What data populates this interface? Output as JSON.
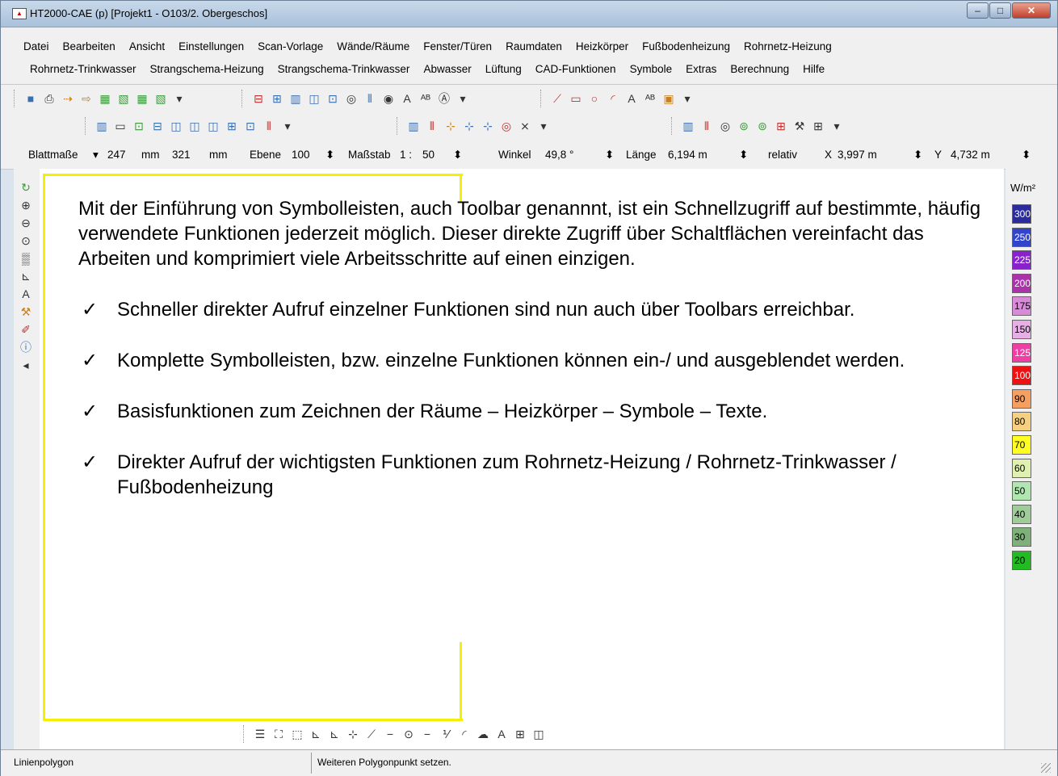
{
  "window": {
    "title": "HT2000-CAE (p)  [Projekt1 - O103/2. Obergeschos]",
    "app_icon": "app-logo-icon",
    "btn_min": "–",
    "btn_max": "□",
    "btn_close": "✕"
  },
  "menu": {
    "row1": [
      "Datei",
      "Bearbeiten",
      "Ansicht",
      "Einstellungen",
      "Scan-Vorlage",
      "Wände/Räume",
      "Fenster/Türen",
      "Raumdaten",
      "Heizkörper",
      "Fußbodenheizung",
      "Rohrnetz-Heizung"
    ],
    "row2": [
      "Rohrnetz-Trinkwasser",
      "Strangschema-Heizung",
      "Strangschema-Trinkwasser",
      "Abwasser",
      "Lüftung",
      "CAD-Funktionen",
      "Symbole",
      "Extras",
      "Berechnung",
      "Hilfe"
    ]
  },
  "propbar": {
    "blattmasse_label": "Blattmaße",
    "blattmasse_dropdown": "▾",
    "width": "247",
    "width_unit": "mm",
    "height": "321",
    "height_unit": "mm",
    "ebene_label": "Ebene",
    "ebene_value": "100",
    "massstab_label": "Maßstab",
    "massstab_prefix": "1 :",
    "massstab_value": "50",
    "winkel_label": "Winkel",
    "winkel_value": "49,8 °",
    "laenge_label": "Länge",
    "laenge_value": "6,194 m",
    "relativ_label": "relativ",
    "x_label": "X",
    "x_value": "3,997 m",
    "y_label": "Y",
    "y_value": "4,732 m",
    "spin_glyph": "⬍"
  },
  "overlay": {
    "intro": "Mit der Einführung von Symbolleisten, auch Toolbar genannnt, ist ein Schnellzugriff auf bestimmte, häufig verwendete Funktionen jederzeit möglich. Dieser direkte Zugriff über Schaltflächen vereinfacht das Arbeiten und komprimiert viele Arbeitsschritte auf einen einzigen.",
    "check_glyph": "✓",
    "bullets": [
      "Schneller direkter Aufruf einzelner Funktionen sind nun auch über Toolbars erreichbar.",
      "Komplette Symbolleisten, bzw. einzelne Funktionen können ein-/ und ausgeblendet werden.",
      "Basisfunktionen zum Zeichnen der Räume – Heizkörper – Symbole – Texte.",
      "Direkter Aufruf der wichtigsten Funktionen zum Rohrnetz-Heizung / Rohrnetz-Trinkwasser / Fußbodenheizung"
    ]
  },
  "legend": {
    "unit_label": "W/m²",
    "items": [
      {
        "label": "300",
        "color": "#2b2b9e"
      },
      {
        "label": "250",
        "color": "#3344cc"
      },
      {
        "label": "225",
        "color": "#8822cc"
      },
      {
        "label": "200",
        "color": "#aa33aa"
      },
      {
        "label": "175",
        "color": "#d98ad9"
      },
      {
        "label": "150",
        "color": "#e6b0e6"
      },
      {
        "label": "125",
        "color": "#ee3fa5"
      },
      {
        "label": "100",
        "color": "#ee1111"
      },
      {
        "label": "90",
        "color": "#f5a060"
      },
      {
        "label": "80",
        "color": "#f5d080"
      },
      {
        "label": "70",
        "color": "#ffff22"
      },
      {
        "label": "60",
        "color": "#dff0b0"
      },
      {
        "label": "50",
        "color": "#b0e6b0"
      },
      {
        "label": "40",
        "color": "#a0cc9a"
      },
      {
        "label": "30",
        "color": "#7fb07a"
      },
      {
        "label": "20",
        "color": "#22bb22"
      }
    ]
  },
  "status": {
    "left": "Linienpolygon",
    "right": "Weiteren Polygonpunkt setzen."
  },
  "icon_glyphs": {
    "save": "■",
    "print": "⎙",
    "drill": "⇢",
    "drill2": "⇨",
    "dxf": "▦",
    "dwg": "▧",
    "dropdown": "▾",
    "wall": "⊟",
    "grid": "⊞",
    "radiator": "▥",
    "door": "◫",
    "room": "⊡",
    "target": "◎",
    "bars": "⫴",
    "eye": "◉",
    "text": "A",
    "ab": "ᴬᴮ",
    "compass": "Ⓐ",
    "line": "⟋",
    "rect": "▭",
    "circle": "○",
    "arc": "◜",
    "image": "▣",
    "refresh": "↻",
    "zoom_in": "⊕",
    "zoom_out": "⊖",
    "zoom_fit": "⊙",
    "hatch": "▒",
    "axis": "⊾",
    "tool": "⚒",
    "eraser": "✐",
    "info": "ⓘ",
    "small": "◂",
    "cs1": "☰",
    "cs2": "⛶",
    "cs3": "⬚",
    "node": "⊹",
    "minus": "−",
    "slash": "⁄",
    "ring": "⊚",
    "scale": "⅟",
    "bubble": "☁",
    "cross": "⨯"
  }
}
